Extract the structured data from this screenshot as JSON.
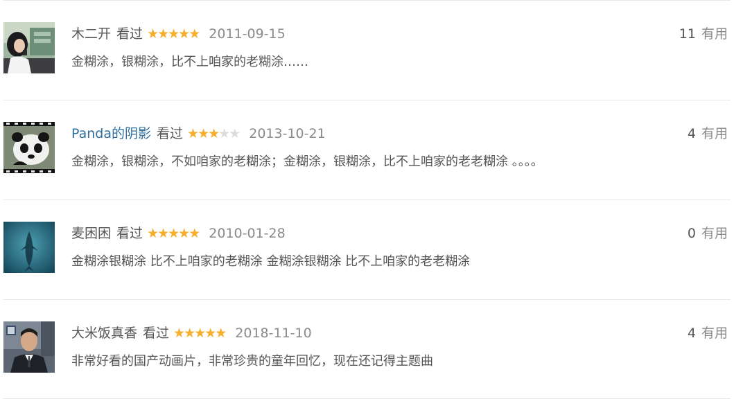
{
  "comments": [
    {
      "username": "木二开",
      "status": "看过",
      "rating": 5,
      "date": "2011-09-15",
      "useful_count": "11",
      "useful_label": "有用",
      "content": "金糊涂，银糊涂，比不上咱家的老糊涂……"
    },
    {
      "username": "Panda的阴影",
      "status": "看过",
      "rating": 3,
      "date": "2013-10-21",
      "useful_count": "4",
      "useful_label": "有用",
      "content": "金糊涂，银糊涂，不如咱家的老糊涂；金糊涂，银糊涂，比不上咱家的老老糊涂 。。。。"
    },
    {
      "username": "麦困困",
      "status": "看过",
      "rating": 5,
      "date": "2010-01-28",
      "useful_count": "0",
      "useful_label": "有用",
      "content": "金糊涂银糊涂 比不上咱家的老糊涂 金糊涂银糊涂 比不上咱家的老老糊涂"
    },
    {
      "username": "大米饭真香",
      "status": "看过",
      "rating": 5,
      "date": "2018-11-10",
      "useful_count": "4",
      "useful_label": "有用",
      "content": "非常好看的国产动画片，非常珍贵的童年回忆，现在还记得主题曲"
    }
  ],
  "colors": {
    "star_on": "#f6ae2d",
    "star_off": "#dcdcdc",
    "link": "#2e6e9e"
  }
}
